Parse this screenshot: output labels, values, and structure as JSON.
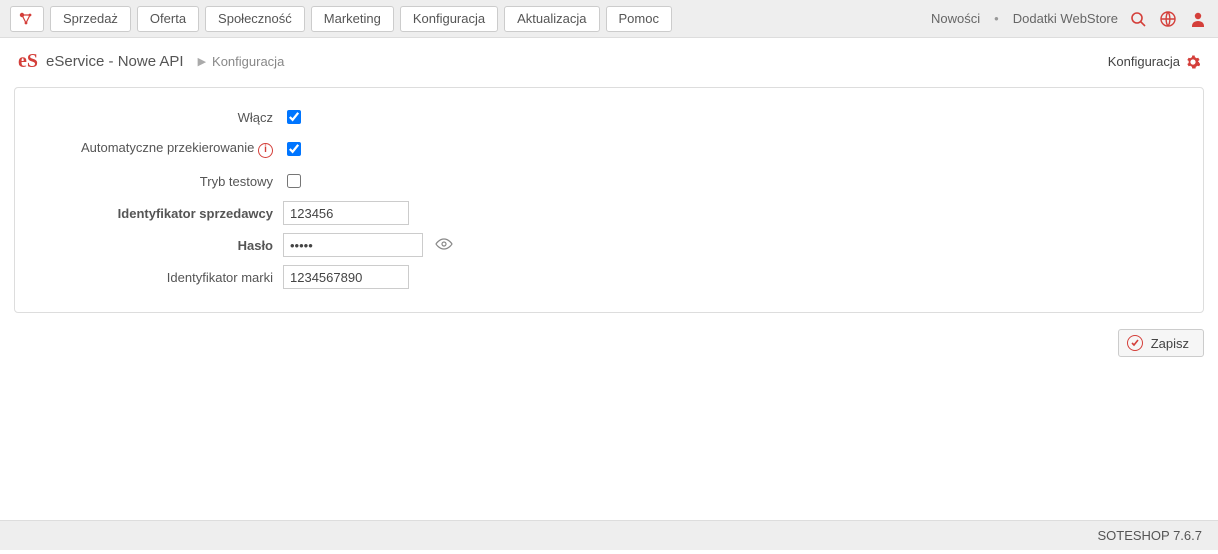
{
  "topbar": {
    "menu": [
      "Sprzedaż",
      "Oferta",
      "Społeczność",
      "Marketing",
      "Konfiguracja",
      "Aktualizacja",
      "Pomoc"
    ],
    "news_label": "Nowości",
    "webstore_label": "Dodatki WebStore"
  },
  "breadcrumb": {
    "badge": "eS",
    "title": "eService - Nowe API",
    "sub": "Konfiguracja",
    "right_label": "Konfiguracja"
  },
  "form": {
    "enable": {
      "label": "Włącz",
      "checked": true
    },
    "auto_redirect": {
      "label": "Automatyczne przekierowanie",
      "checked": true,
      "info": "i"
    },
    "test_mode": {
      "label": "Tryb testowy",
      "checked": false
    },
    "merchant_id": {
      "label": "Identyfikator sprzedawcy",
      "value": "123456"
    },
    "password": {
      "label": "Hasło",
      "value": "•••••"
    },
    "brand_id": {
      "label": "Identyfikator marki",
      "value": "1234567890"
    }
  },
  "actions": {
    "save_label": "Zapisz"
  },
  "footer": {
    "text": "SOTESHOP 7.6.7"
  }
}
